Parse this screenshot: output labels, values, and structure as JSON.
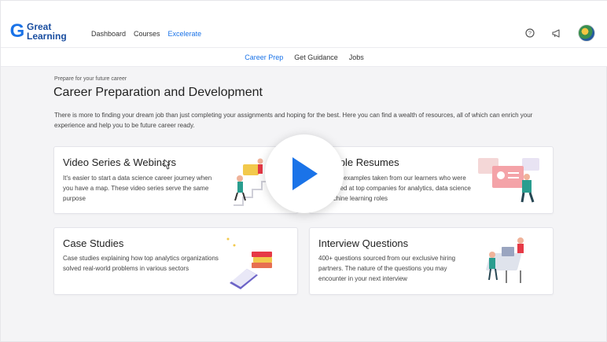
{
  "brand": {
    "logo_line1": "Great",
    "logo_line2": "Learning"
  },
  "nav": {
    "items": [
      "Dashboard",
      "Courses",
      "Excelerate"
    ],
    "active": "Excelerate"
  },
  "subnav": {
    "items": [
      "Career Prep",
      "Get Guidance",
      "Jobs"
    ],
    "active": "Career Prep"
  },
  "page": {
    "kicker": "Prepare for your future career",
    "title": "Career Preparation and Development",
    "description": "There is more to finding your dream job than just completing your assignments and hoping for the best. Here you can find a wealth of resources, all of which can enrich your experience and help you to be future career ready."
  },
  "cards": [
    {
      "title": "Video Series & Webinars",
      "text": "It's easier to start a data science career journey when you have a map. These video series serve the same purpose"
    },
    {
      "title": "Sample Resumes",
      "text": "Resume examples taken from our learners who were shortlisted at top companies for analytics, data science & machine learning roles"
    },
    {
      "title": "Case Studies",
      "text": "Case studies explaining how top analytics organizations solved real-world problems in various sectors"
    },
    {
      "title": "Interview Questions",
      "text": "400+ questions sourced from our exclusive hiring partners. The nature of the questions you may encounter in your next interview"
    }
  ],
  "icons": {
    "help": "help-circle-icon",
    "announce": "megaphone-icon",
    "play": "play-icon"
  },
  "colors": {
    "accent": "#1a73e8",
    "play": "#1a73e8"
  }
}
